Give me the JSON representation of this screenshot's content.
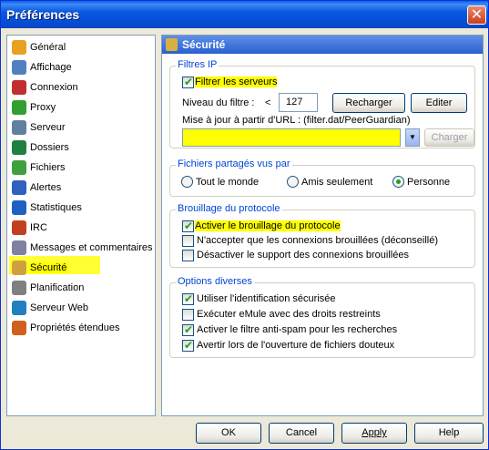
{
  "window": {
    "title": "Préférences",
    "close_glyph": "✕"
  },
  "sidebar": {
    "items": [
      {
        "label": "Général",
        "icon": "gear-icon",
        "color": "#e8a020"
      },
      {
        "label": "Affichage",
        "icon": "display-icon",
        "color": "#5080c0"
      },
      {
        "label": "Connexion",
        "icon": "connection-icon",
        "color": "#c03030"
      },
      {
        "label": "Proxy",
        "icon": "proxy-icon",
        "color": "#30a030"
      },
      {
        "label": "Serveur",
        "icon": "server-icon",
        "color": "#6080a0"
      },
      {
        "label": "Dossiers",
        "icon": "folder-icon",
        "color": "#208040"
      },
      {
        "label": "Fichiers",
        "icon": "files-icon",
        "color": "#40a040"
      },
      {
        "label": "Alertes",
        "icon": "alert-icon",
        "color": "#3060c0"
      },
      {
        "label": "Statistiques",
        "icon": "stats-icon",
        "color": "#2060c0"
      },
      {
        "label": "IRC",
        "icon": "irc-icon",
        "color": "#c04020"
      },
      {
        "label": "Messages et commentaires",
        "icon": "messages-icon",
        "color": "#8080a0"
      },
      {
        "label": "Sécurité",
        "icon": "lock-icon",
        "color": "#d0a040"
      },
      {
        "label": "Planification",
        "icon": "schedule-icon",
        "color": "#808080"
      },
      {
        "label": "Serveur Web",
        "icon": "web-server-icon",
        "color": "#2080c0"
      },
      {
        "label": "Propriétés étendues",
        "icon": "extended-icon",
        "color": "#d06020"
      }
    ],
    "selected_index": 11
  },
  "panel": {
    "title": "Sécurité",
    "ipfilter": {
      "legend": "Filtres IP",
      "filter_servers": {
        "label": "Filtrer les serveurs",
        "checked": true
      },
      "level_label": "Niveau du filtre :",
      "level_op": "<",
      "level_value": "127",
      "reload_button": "Recharger",
      "edit_button": "Editer",
      "url_label": "Mise à jour à partir d'URL : (filter.dat/PeerGuardian)",
      "url_value": "",
      "load_button": "Charger"
    },
    "shared": {
      "legend": "Fichiers partagés vus par",
      "options": [
        "Tout le monde",
        "Amis seulement",
        "Personne"
      ],
      "selected": "Personne"
    },
    "obfuscation": {
      "legend": "Brouillage du protocole",
      "items": [
        {
          "label": "Activer le brouillage du protocole",
          "checked": true
        },
        {
          "label": "N'accepter que les connexions brouillées (déconseillé)",
          "checked": false
        },
        {
          "label": "Désactiver le support des connexions brouillées",
          "checked": false
        }
      ]
    },
    "misc": {
      "legend": "Options diverses",
      "items": [
        {
          "label": "Utiliser l'identification sécurisée",
          "checked": true
        },
        {
          "label": "Exécuter eMule avec des droits restreints",
          "checked": false
        },
        {
          "label": "Activer le filtre anti-spam pour les recherches",
          "checked": true
        },
        {
          "label": "Avertir lors de l'ouverture de fichiers douteux",
          "checked": true
        }
      ]
    }
  },
  "footer": {
    "ok": "OK",
    "cancel": "Cancel",
    "apply": "Apply",
    "help": "Help"
  },
  "colors": {
    "highlight": "#ffff00",
    "check": "#21a121",
    "title_bar": "#0a58e0"
  }
}
